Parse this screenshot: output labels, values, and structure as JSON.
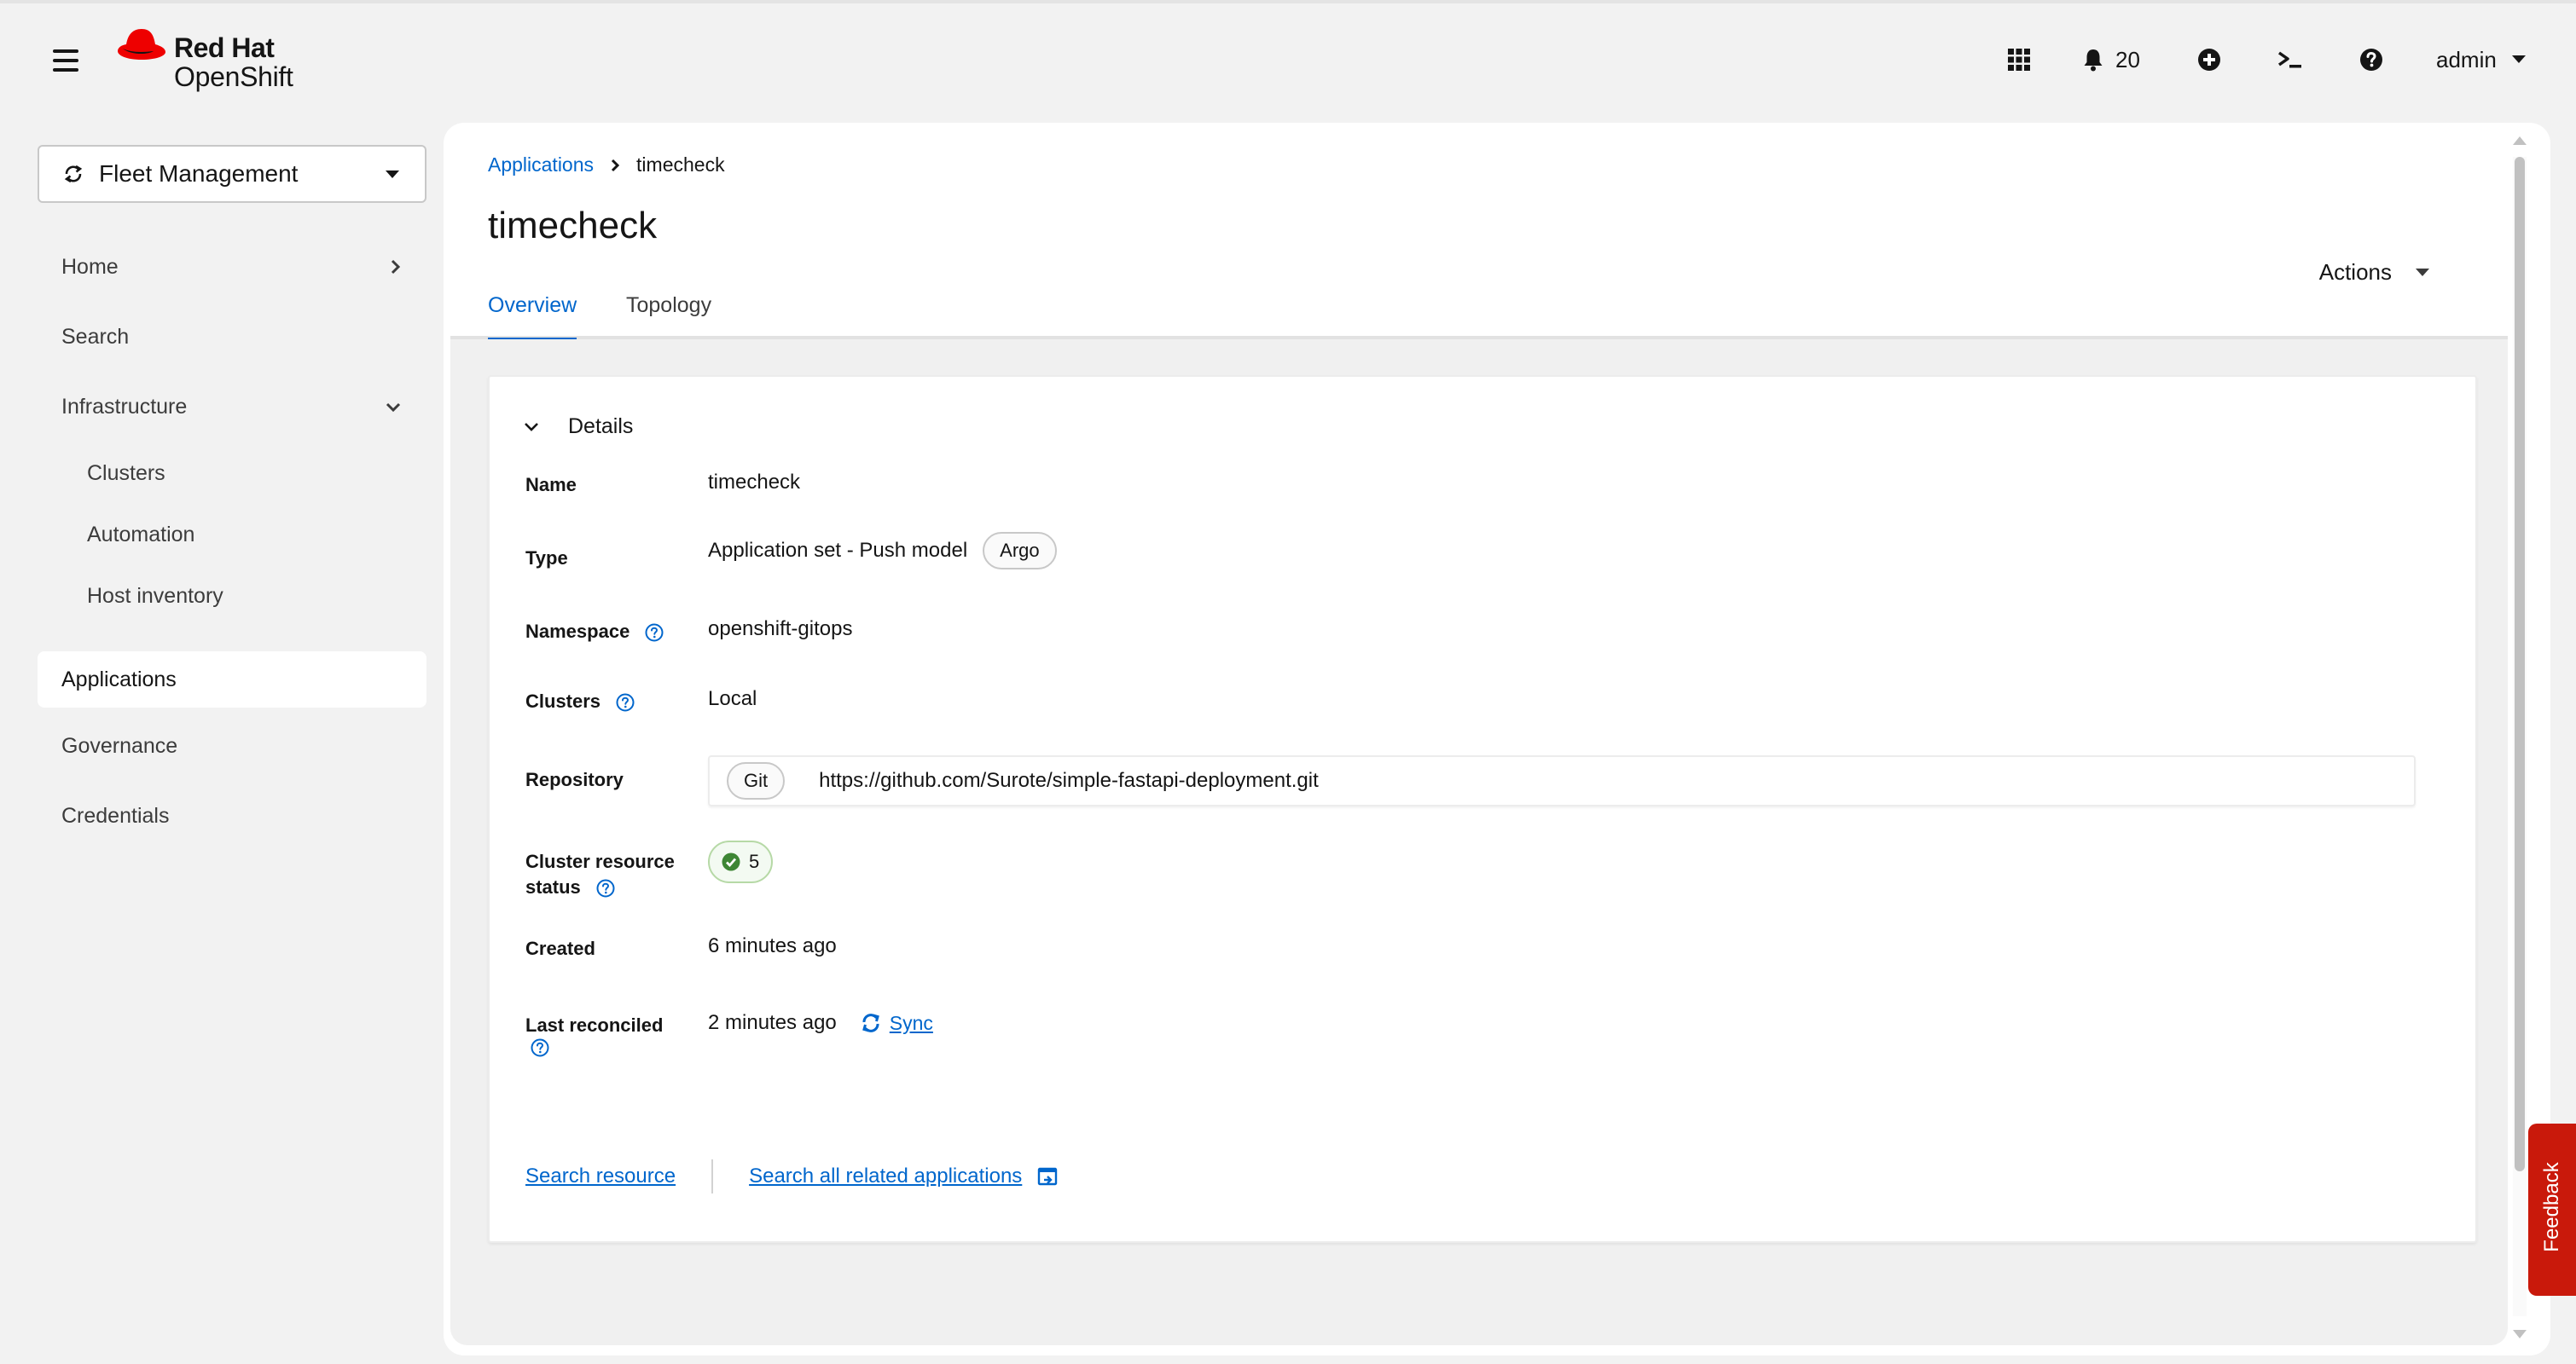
{
  "masthead": {
    "brand_line1": "Red Hat",
    "brand_line2": "OpenShift",
    "notifications_count": "20",
    "user_name": "admin"
  },
  "sidebar": {
    "perspective": "Fleet Management",
    "items": {
      "home": "Home",
      "search": "Search",
      "infrastructure": "Infrastructure",
      "clusters": "Clusters",
      "automation": "Automation",
      "host_inventory": "Host inventory",
      "applications": "Applications",
      "governance": "Governance",
      "credentials": "Credentials"
    }
  },
  "breadcrumb": {
    "parent": "Applications",
    "current": "timecheck"
  },
  "page": {
    "title": "timecheck",
    "actions_label": "Actions",
    "tabs": {
      "overview": "Overview",
      "topology": "Topology"
    }
  },
  "details": {
    "heading": "Details",
    "name_label": "Name",
    "name_value": "timecheck",
    "type_label": "Type",
    "type_value": "Application set - Push model",
    "type_badge": "Argo",
    "namespace_label": "Namespace",
    "namespace_value": "openshift-gitops",
    "clusters_label": "Clusters",
    "clusters_value": "Local",
    "repository_label": "Repository",
    "repository_badge": "Git",
    "repository_url": "https://github.com/Surote/simple-fastapi-deployment.git",
    "cluster_status_label_1": "Cluster resource",
    "cluster_status_label_2": "status",
    "cluster_status_count": "5",
    "created_label": "Created",
    "created_value": "6 minutes ago",
    "reconciled_label": "Last reconciled",
    "reconciled_value": "2 minutes ago",
    "sync_label": "Sync"
  },
  "links": {
    "search_resource": "Search resource",
    "search_related": "Search all related applications"
  },
  "feedback_label": "Feedback",
  "colors": {
    "link_blue": "#0066cc",
    "redhat_red": "#ee0000",
    "feedback_red": "#c9190b",
    "success_green": "#3e8635"
  }
}
